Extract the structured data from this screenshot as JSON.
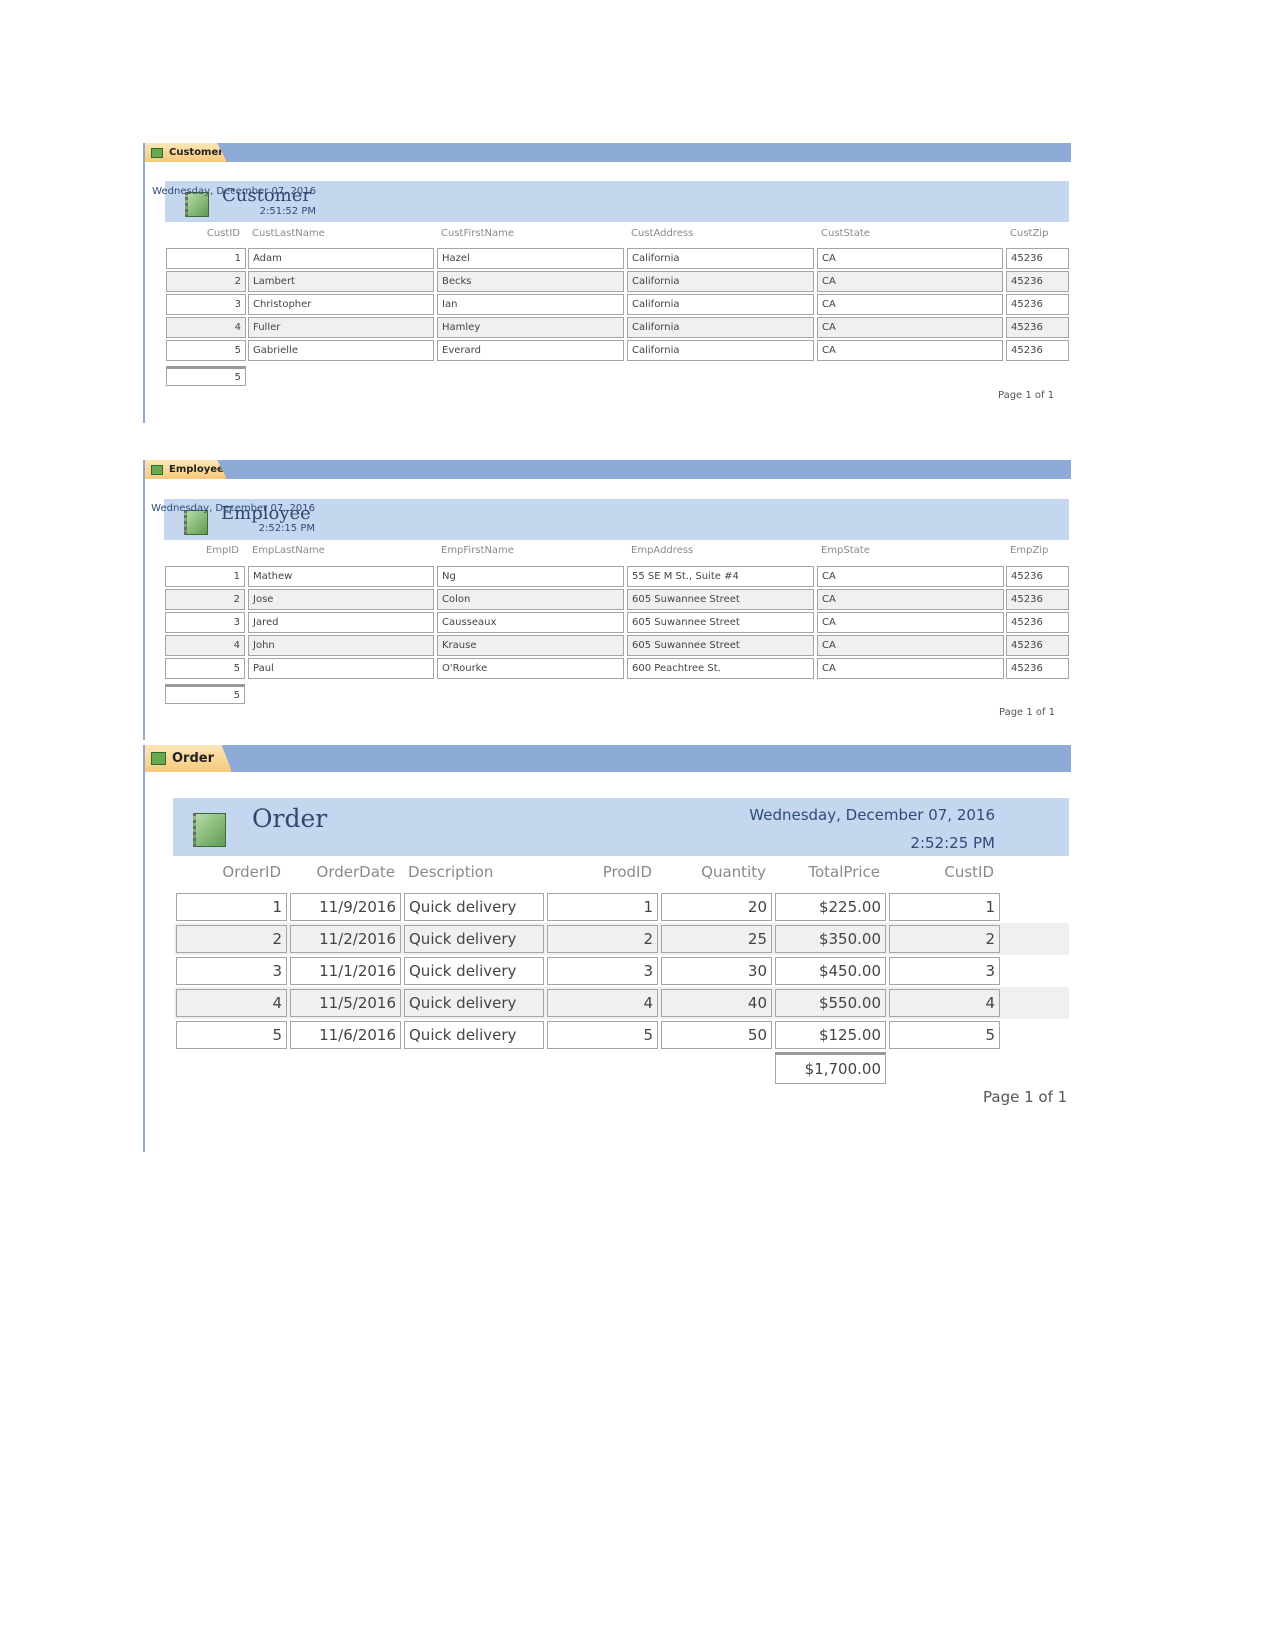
{
  "reports": [
    {
      "tab": "Customer",
      "title": "Customer",
      "date": "Wednesday, December 07, 2016",
      "time": "2:51:52 PM",
      "columns": [
        "CustID",
        "CustLastName",
        "CustFirstName",
        "CustAddress",
        "CustState",
        "CustZip"
      ],
      "rows": [
        [
          "1",
          "Adam",
          "Hazel",
          "California",
          "CA",
          "45236"
        ],
        [
          "2",
          "Lambert",
          "Becks",
          "California",
          "CA",
          "45236"
        ],
        [
          "3",
          "Christopher",
          "Ian",
          "California",
          "CA",
          "45236"
        ],
        [
          "4",
          "Fuller",
          "Hamley",
          "California",
          "CA",
          "45236"
        ],
        [
          "5",
          "Gabrielle",
          "Everard",
          "California",
          "CA",
          "45236"
        ]
      ],
      "total": "5",
      "page": "Page 1 of 1"
    },
    {
      "tab": "Employee",
      "title": "Employee",
      "date": "Wednesday, December 07, 2016",
      "time": "2:52:15 PM",
      "columns": [
        "EmpID",
        "EmpLastName",
        "EmpFirstName",
        "EmpAddress",
        "EmpState",
        "EmpZip"
      ],
      "rows": [
        [
          "1",
          "Mathew",
          "Ng",
          "55 SE M St., Suite #4",
          "CA",
          "45236"
        ],
        [
          "2",
          "Jose",
          "Colon",
          "605 Suwannee Street",
          "CA",
          "45236"
        ],
        [
          "3",
          "Jared",
          "Causseaux",
          "605 Suwannee Street",
          "CA",
          "45236"
        ],
        [
          "4",
          "John",
          "Krause",
          "605 Suwannee Street",
          "CA",
          "45236"
        ],
        [
          "5",
          "Paul",
          "O'Rourke",
          "600 Peachtree St.",
          "CA",
          "45236"
        ]
      ],
      "total": "5",
      "page": "Page 1 of 1"
    },
    {
      "tab": "Order",
      "title": "Order",
      "date": "Wednesday, December 07, 2016",
      "time": "2:52:25 PM",
      "columns": [
        "OrderID",
        "OrderDate",
        "Description",
        "ProdID",
        "Quantity",
        "TotalPrice",
        "CustID"
      ],
      "rows": [
        [
          "1",
          "11/9/2016",
          "Quick delivery",
          "1",
          "20",
          "$225.00",
          "1"
        ],
        [
          "2",
          "11/2/2016",
          "Quick delivery",
          "2",
          "25",
          "$350.00",
          "2"
        ],
        [
          "3",
          "11/1/2016",
          "Quick delivery",
          "3",
          "30",
          "$450.00",
          "3"
        ],
        [
          "4",
          "11/5/2016",
          "Quick delivery",
          "4",
          "40",
          "$550.00",
          "4"
        ],
        [
          "5",
          "11/6/2016",
          "Quick delivery",
          "5",
          "50",
          "$125.00",
          "5"
        ]
      ],
      "total": "$1,700.00",
      "page": "Page 1 of 1"
    }
  ]
}
